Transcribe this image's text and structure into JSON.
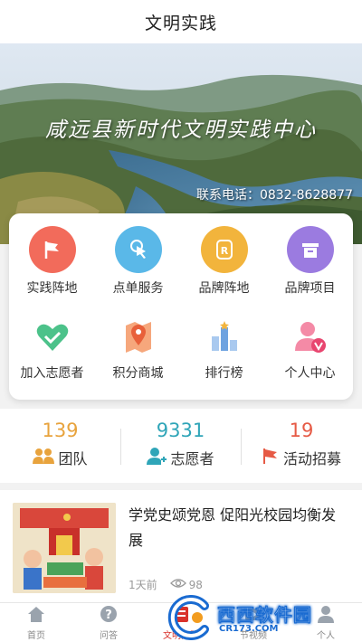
{
  "header": {
    "title": "文明实践"
  },
  "banner": {
    "title": "咸远县新时代文明实践中心",
    "phone": "联系电话：0832-8628877"
  },
  "grid": [
    {
      "label": "实践阵地",
      "icon": "flag-icon",
      "color": "#f26b5b"
    },
    {
      "label": "点单服务",
      "icon": "tap-icon",
      "color": "#5ab8e8"
    },
    {
      "label": "品牌阵地",
      "icon": "badge-r-icon",
      "color": "#f2b43c"
    },
    {
      "label": "品牌项目",
      "icon": "box-icon",
      "color": "#9b7be0"
    },
    {
      "label": "加入志愿者",
      "icon": "handshake-heart-icon",
      "color": "#4cc28a"
    },
    {
      "label": "积分商城",
      "icon": "map-pin-icon",
      "color": "#f08a5d"
    },
    {
      "label": "排行榜",
      "icon": "bar-chart-icon",
      "color": "#8ab4e8"
    },
    {
      "label": "个人中心",
      "icon": "person-v-icon",
      "color": "#f06a8c"
    }
  ],
  "stats": [
    {
      "value": "139",
      "label": "团队",
      "icon": "team-icon",
      "color": "#e8a33d"
    },
    {
      "value": "9331",
      "label": "志愿者",
      "icon": "volunteer-icon",
      "color": "#2fa5b8"
    },
    {
      "value": "19",
      "label": "活动招募",
      "icon": "red-flag-icon",
      "color": "#e65a45"
    }
  ],
  "news": {
    "title": "学党史颂党恩 促阳光校园均衡发展",
    "time": "1天前",
    "views": "98"
  },
  "tabbar": [
    {
      "label": "首页",
      "icon": "home-icon"
    },
    {
      "label": "问答",
      "icon": "question-icon"
    },
    {
      "label": "文明实践",
      "icon": "practice-icon",
      "active": true
    },
    {
      "label": "节视频",
      "icon": "video-icon"
    },
    {
      "label": "个人",
      "icon": "user-icon"
    }
  ],
  "watermark": {
    "text": "西西软件园",
    "sub": "CR173.COM"
  }
}
